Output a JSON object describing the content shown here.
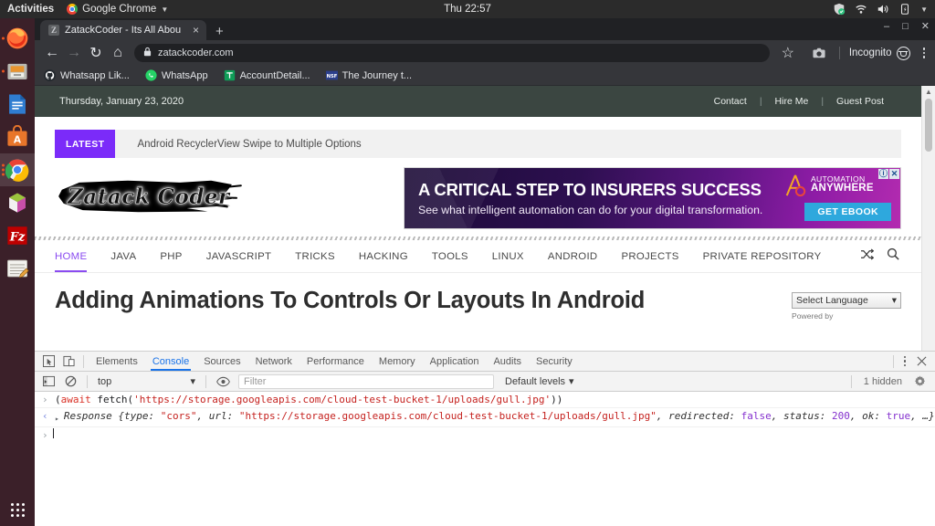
{
  "os": {
    "topbar": {
      "activities": "Activities",
      "app_name": "Google Chrome",
      "clock": "Thu 22:57",
      "indicators": [
        "shield-icon",
        "wifi-icon",
        "volume-icon",
        "battery-icon",
        "chevron-down-icon"
      ]
    },
    "dock": {
      "items": [
        {
          "name": "firefox",
          "label": "Firefox",
          "running": true,
          "active": false
        },
        {
          "name": "files",
          "label": "Files",
          "running": true,
          "active": false
        },
        {
          "name": "libreoffice-writer",
          "label": "LibreOffice Writer",
          "running": false,
          "active": false
        },
        {
          "name": "ubuntu-software",
          "label": "Ubuntu Software",
          "running": false,
          "active": false
        },
        {
          "name": "google-chrome",
          "label": "Google Chrome",
          "running": true,
          "active": true
        },
        {
          "name": "rhythmbox",
          "label": "Rhythmbox",
          "running": false,
          "active": false
        },
        {
          "name": "filezilla",
          "label": "FileZilla",
          "running": false,
          "active": false
        },
        {
          "name": "text-editor",
          "label": "Text Editor",
          "running": false,
          "active": false
        }
      ],
      "show_apps_label": "Show Applications"
    }
  },
  "browser": {
    "tab": {
      "favicon_letter": "Z",
      "title": "ZatackCoder - Its All Abou",
      "close_label": "×"
    },
    "new_tab_label": "+",
    "window_controls": {
      "minimize": "–",
      "maximize": "□",
      "close": "✕"
    },
    "toolbar": {
      "back": "←",
      "forward": "→",
      "reload": "↻",
      "home": "⌂",
      "url": "zatackcoder.com",
      "lock_icon": "padlock-icon",
      "bookmark_star": "☆",
      "screenshot_icon": "camera-icon",
      "incognito_label": "Incognito",
      "menu_label": "Customize and control Google Chrome"
    },
    "bookmarks": [
      {
        "label": "Whatsapp Lik...",
        "icon": "github-icon"
      },
      {
        "label": "WhatsApp",
        "icon": "whatsapp-icon"
      },
      {
        "label": "AccountDetail...",
        "icon": "sheets-icon"
      },
      {
        "label": "The Journey t...",
        "icon": "nsf-icon"
      }
    ]
  },
  "page": {
    "topbar": {
      "date": "Thursday, January 23, 2020",
      "links": [
        "Contact",
        "Hire Me",
        "Guest Post"
      ],
      "separator": "|"
    },
    "latest": {
      "badge": "LATEST",
      "headline": "Android RecyclerView Swipe to Multiple Options"
    },
    "logo": {
      "text": "Zatack Coder",
      "alt": "Zatack Coder logo"
    },
    "ad": {
      "headline": "A CRITICAL STEP TO INSURERS SUCCESS",
      "subline": "See what intelligent automation can do for your digital transformation.",
      "brand_line1": "AUTOMATION",
      "brand_line2": "ANYWHERE",
      "cta": "GET EBOOK",
      "info_badge": "ⓘ",
      "close_badge": "✕",
      "accent_color": "#2ea8dd"
    },
    "nav": {
      "items": [
        "HOME",
        "JAVA",
        "PHP",
        "JAVASCRIPT",
        "TRICKS",
        "HACKING",
        "TOOLS",
        "LINUX",
        "ANDROID",
        "PROJECTS",
        "PRIVATE REPOSITORY"
      ],
      "active": "HOME",
      "active_color": "#8a4bf0",
      "right_icons": [
        "shuffle-icon",
        "search-icon"
      ]
    },
    "article": {
      "title": "Adding Animations To Controls Or Layouts In Android"
    },
    "translate": {
      "selected": "Select Language",
      "caret": "▾",
      "powered_by": "Powered by"
    }
  },
  "devtools": {
    "tabs": [
      "Elements",
      "Console",
      "Sources",
      "Network",
      "Performance",
      "Memory",
      "Application",
      "Audits",
      "Security"
    ],
    "active_tab": "Console",
    "active_color": "#1a73e8",
    "left_icons": [
      "inspect-icon",
      "device-toolbar-icon"
    ],
    "right_icons": [
      "kebab-menu-icon",
      "close-icon"
    ],
    "console_bar": {
      "sidebar_icon": "console-sidebar-icon",
      "clear_icon": "clear-console-icon",
      "context": "top",
      "context_caret": "▾",
      "eye_icon": "live-expression-icon",
      "filter_placeholder": "Filter",
      "filter_value": "",
      "levels": "Default levels",
      "levels_caret": "▾",
      "hidden_count": "1 hidden",
      "settings_icon": "gear-icon"
    },
    "console": {
      "input_line": {
        "prompt": "›",
        "segments": [
          {
            "text": "(",
            "type": "pun"
          },
          {
            "text": "await",
            "type": "kw"
          },
          {
            "text": " fetch(",
            "type": "fn"
          },
          {
            "text": "'https://storage.googleapis.com/cloud-test-bucket-1/uploads/gull.jpg'",
            "type": "str"
          },
          {
            "text": "))",
            "type": "pun"
          }
        ],
        "raw": "(await fetch('https://storage.googleapis.com/cloud-test-bucket-1/uploads/gull.jpg'))"
      },
      "output_line": {
        "prompt": "‹",
        "triangle": "▸",
        "segments": [
          {
            "text": "Response",
            "type": "italic"
          },
          {
            "text": " {type: ",
            "type": "italic"
          },
          {
            "text": "\"cors\"",
            "type": "str"
          },
          {
            "text": ", url: ",
            "type": "italic"
          },
          {
            "text": "\"https://storage.googleapis.com/cloud-test-bucket-1/uploads/gull.jpg\"",
            "type": "str"
          },
          {
            "text": ", redirected: ",
            "type": "italic"
          },
          {
            "text": "false",
            "type": "bool"
          },
          {
            "text": ", status: ",
            "type": "italic"
          },
          {
            "text": "200",
            "type": "num"
          },
          {
            "text": ", ok: ",
            "type": "italic"
          },
          {
            "text": "true",
            "type": "bool"
          },
          {
            "text": ", …}",
            "type": "italic"
          }
        ],
        "raw": "Response {type: \"cors\", url: \"https://storage.googleapis.com/cloud-test-bucket-1/uploads/gull.jpg\", redirected: false, status: 200, ok: true, …}"
      },
      "new_prompt": "›"
    }
  }
}
